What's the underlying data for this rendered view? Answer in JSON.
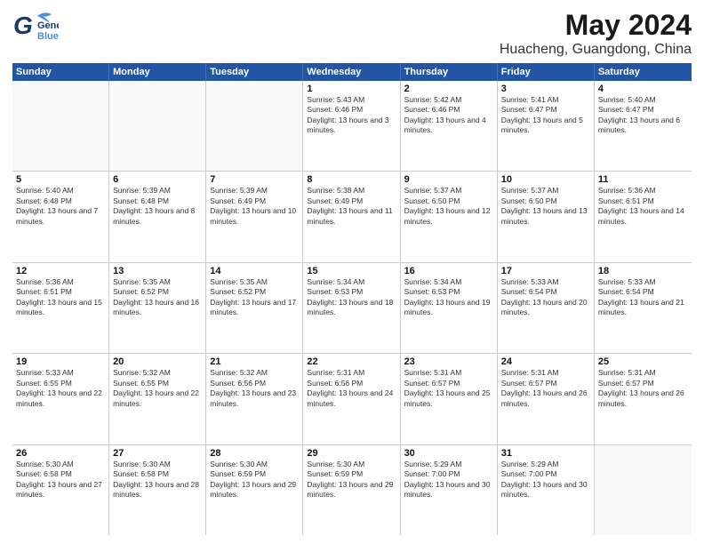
{
  "header": {
    "logo": {
      "general": "General",
      "blue": "Blue"
    },
    "title": "May 2024",
    "subtitle": "Huacheng, Guangdong, China"
  },
  "weekdays": [
    "Sunday",
    "Monday",
    "Tuesday",
    "Wednesday",
    "Thursday",
    "Friday",
    "Saturday"
  ],
  "weeks": [
    [
      {
        "day": "",
        "info": ""
      },
      {
        "day": "",
        "info": ""
      },
      {
        "day": "",
        "info": ""
      },
      {
        "day": "1",
        "info": "Sunrise: 5:43 AM\nSunset: 6:46 PM\nDaylight: 13 hours and 3 minutes."
      },
      {
        "day": "2",
        "info": "Sunrise: 5:42 AM\nSunset: 6:46 PM\nDaylight: 13 hours and 4 minutes."
      },
      {
        "day": "3",
        "info": "Sunrise: 5:41 AM\nSunset: 6:47 PM\nDaylight: 13 hours and 5 minutes."
      },
      {
        "day": "4",
        "info": "Sunrise: 5:40 AM\nSunset: 6:47 PM\nDaylight: 13 hours and 6 minutes."
      }
    ],
    [
      {
        "day": "5",
        "info": "Sunrise: 5:40 AM\nSunset: 6:48 PM\nDaylight: 13 hours and 7 minutes."
      },
      {
        "day": "6",
        "info": "Sunrise: 5:39 AM\nSunset: 6:48 PM\nDaylight: 13 hours and 8 minutes."
      },
      {
        "day": "7",
        "info": "Sunrise: 5:39 AM\nSunset: 6:49 PM\nDaylight: 13 hours and 10 minutes."
      },
      {
        "day": "8",
        "info": "Sunrise: 5:38 AM\nSunset: 6:49 PM\nDaylight: 13 hours and 11 minutes."
      },
      {
        "day": "9",
        "info": "Sunrise: 5:37 AM\nSunset: 6:50 PM\nDaylight: 13 hours and 12 minutes."
      },
      {
        "day": "10",
        "info": "Sunrise: 5:37 AM\nSunset: 6:50 PM\nDaylight: 13 hours and 13 minutes."
      },
      {
        "day": "11",
        "info": "Sunrise: 5:36 AM\nSunset: 6:51 PM\nDaylight: 13 hours and 14 minutes."
      }
    ],
    [
      {
        "day": "12",
        "info": "Sunrise: 5:36 AM\nSunset: 6:51 PM\nDaylight: 13 hours and 15 minutes."
      },
      {
        "day": "13",
        "info": "Sunrise: 5:35 AM\nSunset: 6:52 PM\nDaylight: 13 hours and 16 minutes."
      },
      {
        "day": "14",
        "info": "Sunrise: 5:35 AM\nSunset: 6:52 PM\nDaylight: 13 hours and 17 minutes."
      },
      {
        "day": "15",
        "info": "Sunrise: 5:34 AM\nSunset: 6:53 PM\nDaylight: 13 hours and 18 minutes."
      },
      {
        "day": "16",
        "info": "Sunrise: 5:34 AM\nSunset: 6:53 PM\nDaylight: 13 hours and 19 minutes."
      },
      {
        "day": "17",
        "info": "Sunrise: 5:33 AM\nSunset: 6:54 PM\nDaylight: 13 hours and 20 minutes."
      },
      {
        "day": "18",
        "info": "Sunrise: 5:33 AM\nSunset: 6:54 PM\nDaylight: 13 hours and 21 minutes."
      }
    ],
    [
      {
        "day": "19",
        "info": "Sunrise: 5:33 AM\nSunset: 6:55 PM\nDaylight: 13 hours and 22 minutes."
      },
      {
        "day": "20",
        "info": "Sunrise: 5:32 AM\nSunset: 6:55 PM\nDaylight: 13 hours and 22 minutes."
      },
      {
        "day": "21",
        "info": "Sunrise: 5:32 AM\nSunset: 6:56 PM\nDaylight: 13 hours and 23 minutes."
      },
      {
        "day": "22",
        "info": "Sunrise: 5:31 AM\nSunset: 6:56 PM\nDaylight: 13 hours and 24 minutes."
      },
      {
        "day": "23",
        "info": "Sunrise: 5:31 AM\nSunset: 6:57 PM\nDaylight: 13 hours and 25 minutes."
      },
      {
        "day": "24",
        "info": "Sunrise: 5:31 AM\nSunset: 6:57 PM\nDaylight: 13 hours and 26 minutes."
      },
      {
        "day": "25",
        "info": "Sunrise: 5:31 AM\nSunset: 6:57 PM\nDaylight: 13 hours and 26 minutes."
      }
    ],
    [
      {
        "day": "26",
        "info": "Sunrise: 5:30 AM\nSunset: 6:58 PM\nDaylight: 13 hours and 27 minutes."
      },
      {
        "day": "27",
        "info": "Sunrise: 5:30 AM\nSunset: 6:58 PM\nDaylight: 13 hours and 28 minutes."
      },
      {
        "day": "28",
        "info": "Sunrise: 5:30 AM\nSunset: 6:59 PM\nDaylight: 13 hours and 29 minutes."
      },
      {
        "day": "29",
        "info": "Sunrise: 5:30 AM\nSunset: 6:59 PM\nDaylight: 13 hours and 29 minutes."
      },
      {
        "day": "30",
        "info": "Sunrise: 5:29 AM\nSunset: 7:00 PM\nDaylight: 13 hours and 30 minutes."
      },
      {
        "day": "31",
        "info": "Sunrise: 5:29 AM\nSunset: 7:00 PM\nDaylight: 13 hours and 30 minutes."
      },
      {
        "day": "",
        "info": ""
      }
    ]
  ]
}
